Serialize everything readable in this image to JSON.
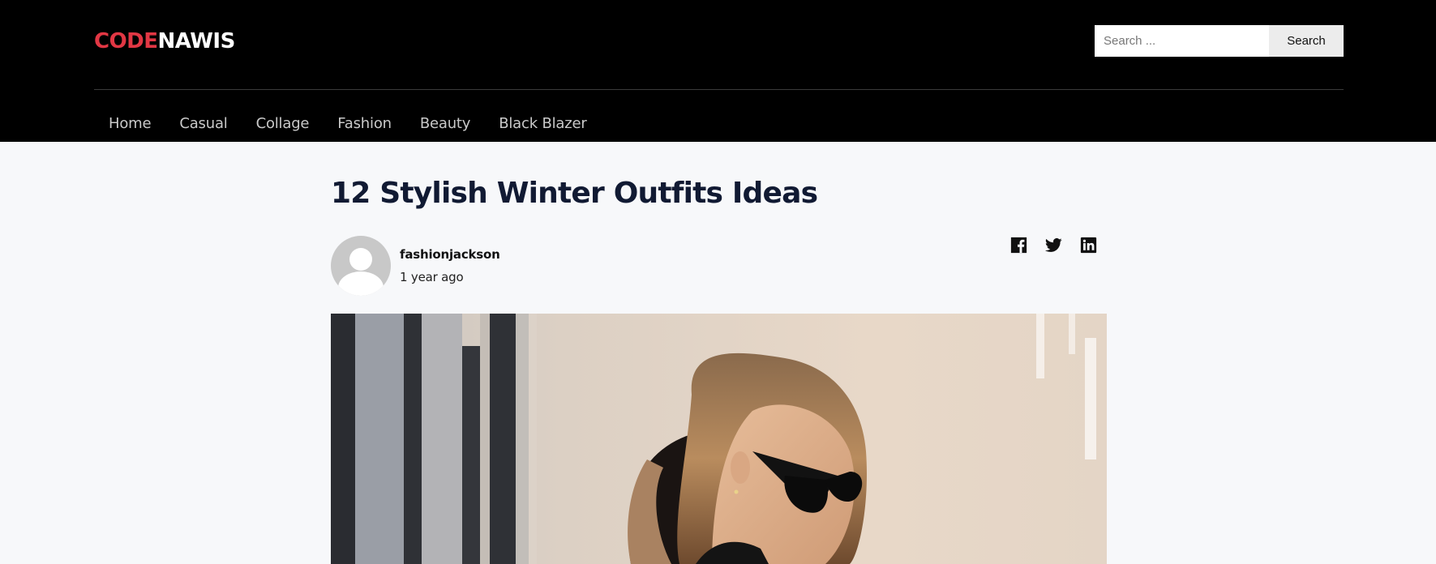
{
  "site": {
    "logo_part1": "CODE",
    "logo_part2": "NAWIS",
    "logo_color_accent": "#e23744",
    "header_bg": "#000000"
  },
  "search": {
    "placeholder": "Search ...",
    "button_label": "Search"
  },
  "nav": {
    "items": [
      {
        "label": "Home"
      },
      {
        "label": "Casual"
      },
      {
        "label": "Collage"
      },
      {
        "label": "Fashion"
      },
      {
        "label": "Beauty"
      },
      {
        "label": "Black Blazer"
      }
    ]
  },
  "post": {
    "title": "12 Stylish Winter Outfits Ideas",
    "author": "fashionjackson",
    "date": "1 year ago",
    "share_icons": [
      "facebook-icon",
      "twitter-icon",
      "linkedin-icon"
    ]
  }
}
